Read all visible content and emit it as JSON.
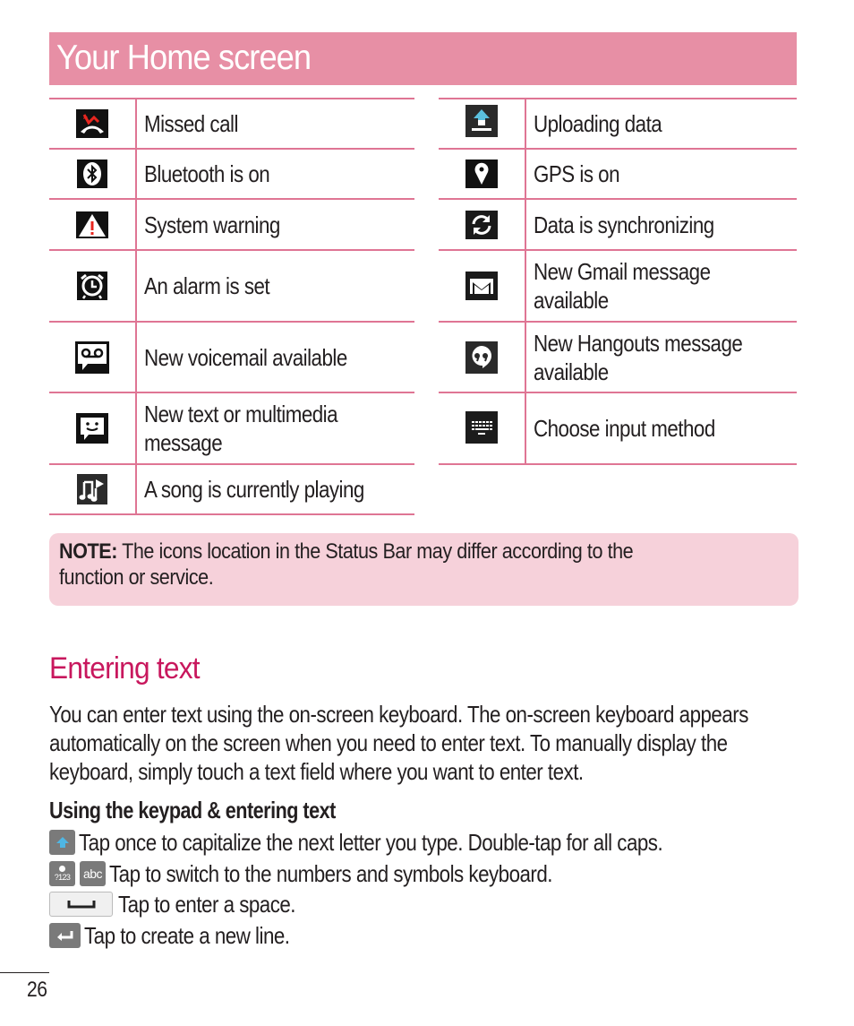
{
  "header": {
    "title": "Your Home screen"
  },
  "colors": {
    "header_band": "#e78fa5",
    "table_rule": "#df7594",
    "note_bg": "#f6d1da",
    "section_title": "#c8175d"
  },
  "icon_table": {
    "left": [
      {
        "icon": "missed-call-icon",
        "label": "Missed call"
      },
      {
        "icon": "bluetooth-icon",
        "label": "Bluetooth is on"
      },
      {
        "icon": "warning-icon",
        "label": "System warning"
      },
      {
        "icon": "alarm-icon",
        "label": "An alarm is set"
      },
      {
        "icon": "voicemail-icon",
        "label": "New voicemail available"
      },
      {
        "icon": "message-icon",
        "label_lines": [
          "New text or multimedia",
          "message"
        ]
      },
      {
        "icon": "music-icon",
        "label": "A song is currently playing"
      }
    ],
    "right": [
      {
        "icon": "upload-icon",
        "label": "Uploading data"
      },
      {
        "icon": "gps-icon",
        "label": "GPS is on"
      },
      {
        "icon": "sync-icon",
        "label": "Data is synchronizing"
      },
      {
        "icon": "gmail-icon",
        "label_lines": [
          "New Gmail message",
          "available"
        ]
      },
      {
        "icon": "hangouts-icon",
        "label_lines": [
          "New Hangouts message",
          "available"
        ]
      },
      {
        "icon": "keyboard-icon",
        "label": "Choose input method"
      }
    ]
  },
  "note": {
    "label": "NOTE:",
    "text": " The icons location in the Status Bar may differ according to the",
    "text2": "function or service."
  },
  "section": {
    "title": "Entering text",
    "paragraph_lines": [
      "You can enter text using the on-screen keyboard. The on-screen keyboard appears",
      "automatically on the screen when you need to enter text. To manually display the",
      "keyboard, simply touch a text field where you want to enter text."
    ],
    "subheading": "Using the keypad & entering text",
    "keys": [
      {
        "icon": "shift-key-icon",
        "text": "Tap once to capitalize the next letter you type. Double-tap for all caps."
      },
      {
        "icon": "symbols-key-icon",
        "key_label_1": "?123",
        "key_label_2": "abc",
        "text": "Tap to switch to the numbers and symbols keyboard."
      },
      {
        "icon": "space-key-icon",
        "text": "Tap to enter a space."
      },
      {
        "icon": "enter-key-icon",
        "text": "Tap to create a new line."
      }
    ]
  },
  "footer": {
    "page_number": "26"
  }
}
